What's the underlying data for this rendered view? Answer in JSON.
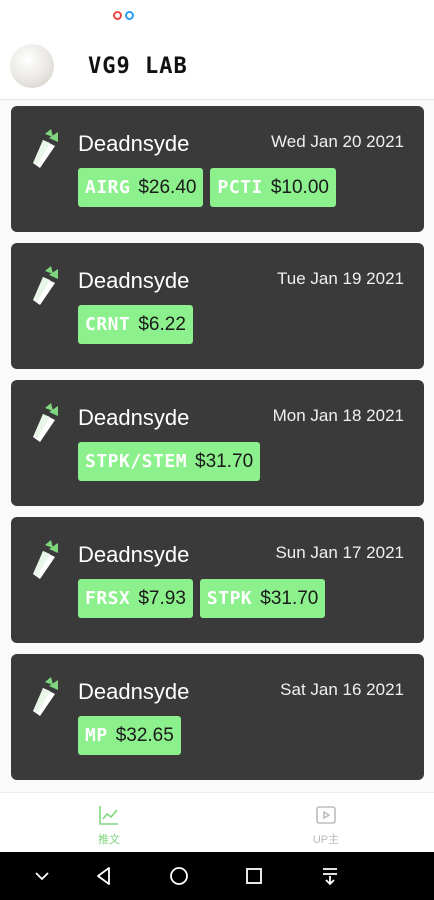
{
  "header": {
    "title": "VG9 LAB"
  },
  "cards": [
    {
      "user": "Deadnsyde",
      "date": "Wed Jan 20 2021",
      "tickers": [
        {
          "symbol": "AIRG",
          "price": "$26.40"
        },
        {
          "symbol": "PCTI",
          "price": "$10.00"
        }
      ]
    },
    {
      "user": "Deadnsyde",
      "date": "Tue Jan 19 2021",
      "tickers": [
        {
          "symbol": "CRNT",
          "price": "$6.22"
        }
      ]
    },
    {
      "user": "Deadnsyde",
      "date": "Mon Jan 18 2021",
      "tickers": [
        {
          "symbol": "STPK/STEM",
          "price": "$31.70"
        }
      ]
    },
    {
      "user": "Deadnsyde",
      "date": "Sun Jan 17 2021",
      "tickers": [
        {
          "symbol": "FRSX",
          "price": "$7.93"
        },
        {
          "symbol": "STPK",
          "price": "$31.70"
        }
      ]
    },
    {
      "user": "Deadnsyde",
      "date": "Sat Jan 16 2021",
      "tickers": [
        {
          "symbol": "MP",
          "price": "$32.65"
        }
      ]
    }
  ],
  "bottom_nav": {
    "items": [
      {
        "label": "推文",
        "icon": "chart-line-icon",
        "active": true
      },
      {
        "label": "UP主",
        "icon": "play-icon",
        "active": false
      }
    ]
  },
  "colors": {
    "card_bg": "#3a3a3a",
    "ticker_bg": "#8cf08c",
    "accent": "#7fd67f",
    "brand_leek": "#7fd67f"
  }
}
